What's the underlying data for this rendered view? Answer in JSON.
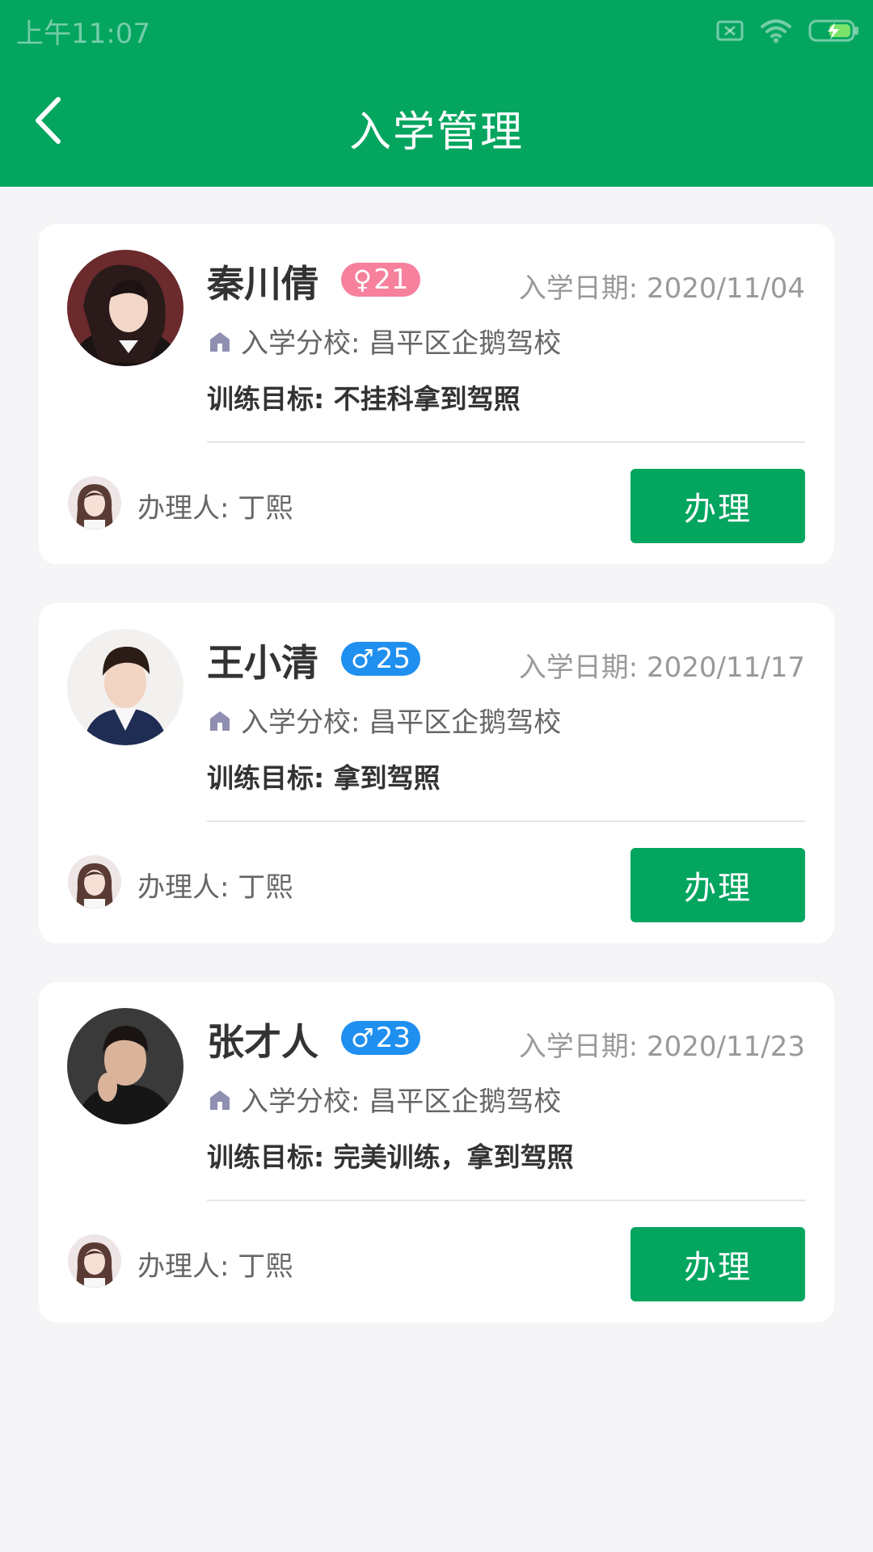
{
  "status_bar": {
    "time": "上午11:07",
    "icons": [
      "sim-blocked-icon",
      "wifi-icon",
      "battery-charging-icon"
    ]
  },
  "header": {
    "title": "入学管理",
    "back_icon": "back-chevron-icon",
    "background_color": "#03a55f"
  },
  "colors": {
    "accent": "#03a55f",
    "female_badge": "#f7809c",
    "male_badge": "#1f8ff0"
  },
  "records": [
    {
      "name": "秦川倩",
      "gender_symbol": "♀",
      "gender": "female",
      "age": "21",
      "date": "入学日期: 2020/11/04",
      "school": "入学分校: 昌平区企鹅驾校",
      "goal": "训练目标: 不挂科拿到驾照",
      "handler": "办理人: 丁熙",
      "action": "办理"
    },
    {
      "name": "王小清",
      "gender_symbol": "♂",
      "gender": "male",
      "age": "25",
      "date": "入学日期: 2020/11/17",
      "school": "入学分校: 昌平区企鹅驾校",
      "goal": "训练目标: 拿到驾照",
      "handler": "办理人: 丁熙",
      "action": "办理"
    },
    {
      "name": "张才人",
      "gender_symbol": "♂",
      "gender": "male",
      "age": "23",
      "date": "入学日期: 2020/11/23",
      "school": "入学分校: 昌平区企鹅驾校",
      "goal": "训练目标: 完美训练，拿到驾照",
      "handler": "办理人: 丁熙",
      "action": "办理"
    }
  ]
}
